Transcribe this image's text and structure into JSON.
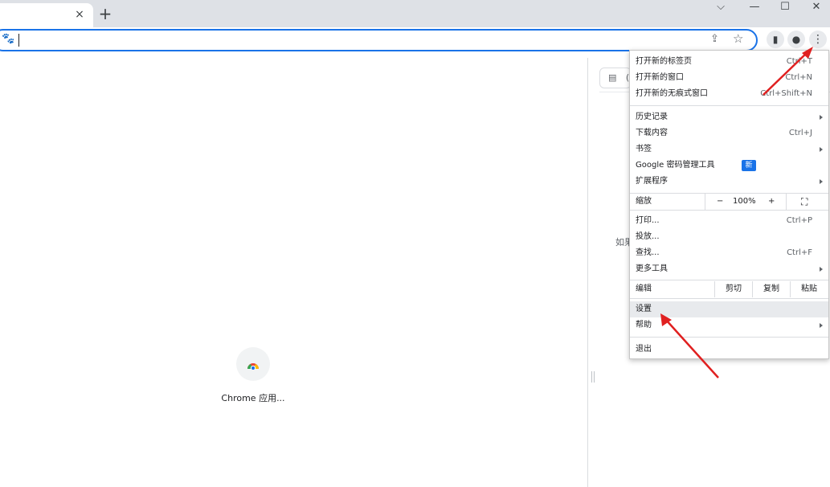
{
  "tabstrip": {
    "tab_close_icon": "×",
    "new_tab_icon": "+",
    "window_controls": {
      "dropdown": "⌵",
      "minimize": "—",
      "maximize": "☐",
      "close": "✕"
    }
  },
  "toolbar": {
    "address_value": "",
    "search_engine_icon": "baidu-paw-icon",
    "share_icon": "⇪",
    "bookmark_icon": "☆",
    "side_panel_icon": "▮",
    "profile_icon": "●",
    "menu_icon": "⋮"
  },
  "page": {
    "app_label": "Chrome 应用..."
  },
  "side_panel": {
    "header_icon": "▤",
    "header_text": "(",
    "body_text": "如果"
  },
  "menu": {
    "new_tab": "打开新的标签页",
    "new_tab_shortcut": "Ctrl+T",
    "new_window": "打开新的窗口",
    "new_window_shortcut": "Ctrl+N",
    "incognito": "打开新的无痕式窗口",
    "incognito_shortcut": "Ctrl+Shift+N",
    "history": "历史记录",
    "downloads": "下载内容",
    "downloads_shortcut": "Ctrl+J",
    "bookmarks": "书签",
    "password_manager": "Google 密码管理工具",
    "new_badge": "新",
    "extensions": "扩展程序",
    "zoom": "缩放",
    "zoom_minus": "−",
    "zoom_value": "100%",
    "zoom_plus": "+",
    "fullscreen_icon": "⛶",
    "print": "打印...",
    "print_shortcut": "Ctrl+P",
    "cast": "投放...",
    "find": "查找...",
    "find_shortcut": "Ctrl+F",
    "more_tools": "更多工具",
    "edit": "编辑",
    "cut": "剪切",
    "copy": "复制",
    "paste": "粘贴",
    "settings": "设置",
    "help": "帮助",
    "exit": "退出"
  },
  "colors": {
    "accent": "#1a73e8",
    "annotation_arrow": "#e02020",
    "tabstrip_bg": "#dee1e6"
  }
}
